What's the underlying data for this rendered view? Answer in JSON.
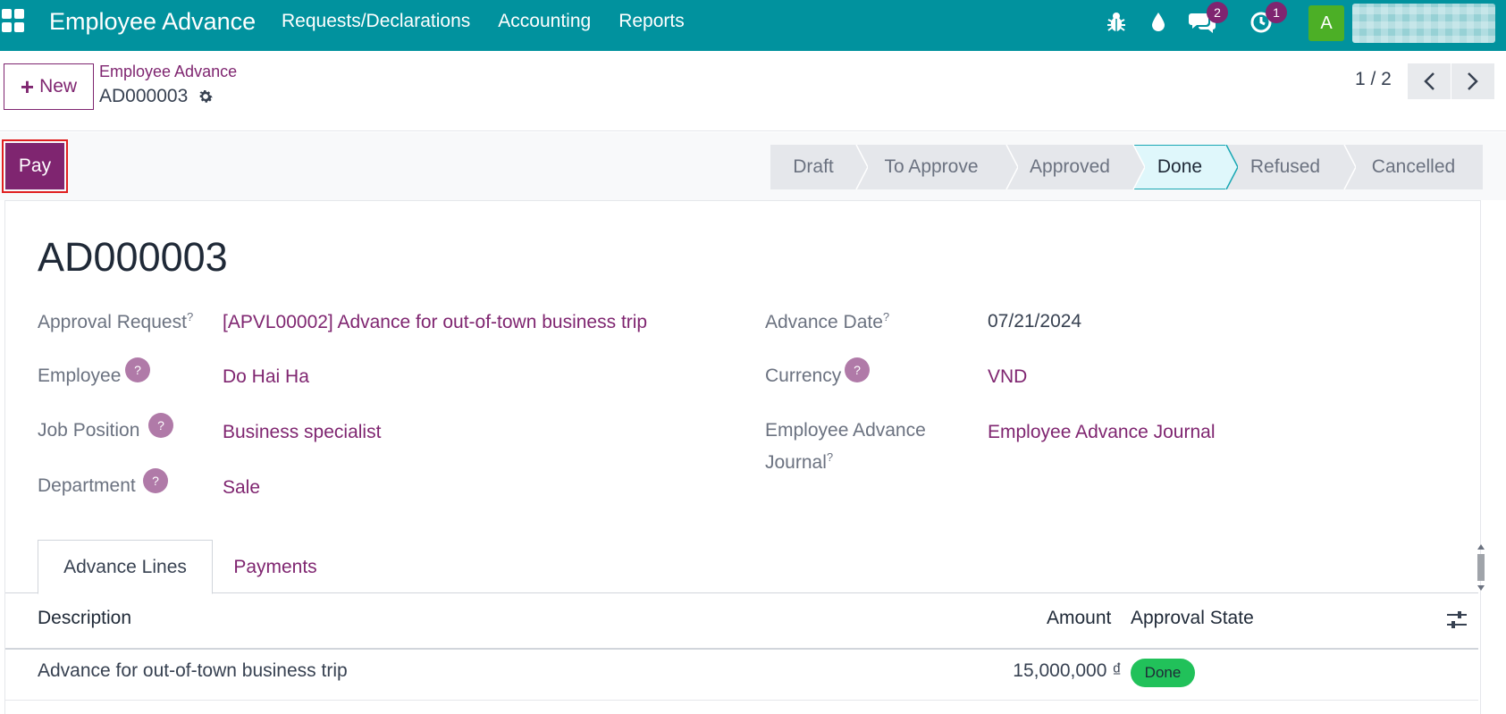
{
  "navbar": {
    "app_title": "Employee Advance",
    "menu": [
      "Requests/Declarations",
      "Accounting",
      "Reports"
    ],
    "messages_count": "2",
    "activities_count": "1",
    "avatar_letter": "A",
    "accent": "#01929e"
  },
  "control": {
    "new_label": "New",
    "breadcrumb": "Employee Advance",
    "record": "AD000003",
    "pager": "1 / 2"
  },
  "actions": {
    "pay_label": "Pay"
  },
  "statusbar": {
    "stages": [
      "Draft",
      "To Approve",
      "Approved",
      "Done",
      "Refused",
      "Cancelled"
    ],
    "active": "Done"
  },
  "form": {
    "title": "AD000003",
    "approval_request_label": "Approval Request",
    "approval_request_value": "[APVL00002] Advance for out-of-town business trip",
    "employee_label": "Employee",
    "employee_value": "Do Hai Ha",
    "job_position_label": "Job Position",
    "job_position_value": "Business specialist",
    "department_label": "Department",
    "department_value": "Sale",
    "advance_date_label": "Advance Date",
    "advance_date_value": "07/21/2024",
    "currency_label": "Currency",
    "currency_value": "VND",
    "journal_label_1": "Employee Advance",
    "journal_label_2": "Journal",
    "journal_value": "Employee Advance Journal",
    "help_mark": "?"
  },
  "tabs": [
    "Advance Lines",
    "Payments"
  ],
  "lines": {
    "headers": {
      "description": "Description",
      "amount": "Amount",
      "state": "Approval State"
    },
    "rows": [
      {
        "description": "Advance for out-of-town business trip",
        "amount": "15,000,000 ₫",
        "state": "Done"
      }
    ]
  }
}
